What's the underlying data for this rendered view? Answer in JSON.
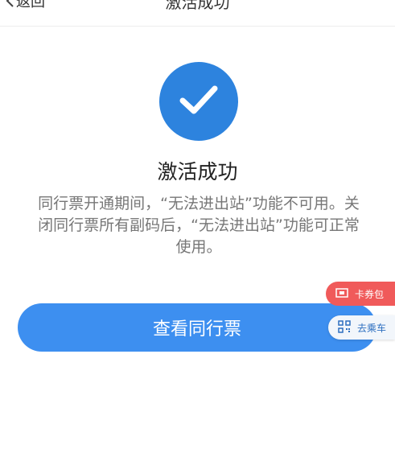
{
  "nav": {
    "back_label": "返回",
    "title": "激活成功"
  },
  "main": {
    "heading": "激活成功",
    "description": "同行票开通期间，“无法进出站”功能不可用。关闭同行票所有副码后，“无法进出站”功能可正常使用。",
    "view_button": "查看同行票"
  },
  "floating": {
    "card_pack": "卡券包",
    "go_ride": "去乘车"
  },
  "colors": {
    "accent": "#2d83de",
    "button": "#3d8ff0",
    "card_pack_bg": "#f05a5a",
    "go_ride_text": "#2d6fc0"
  },
  "icons": {
    "back": "chevron-left-icon",
    "success": "checkmark-icon",
    "card_pack": "ticket-icon",
    "go_ride": "qr-code-icon"
  }
}
